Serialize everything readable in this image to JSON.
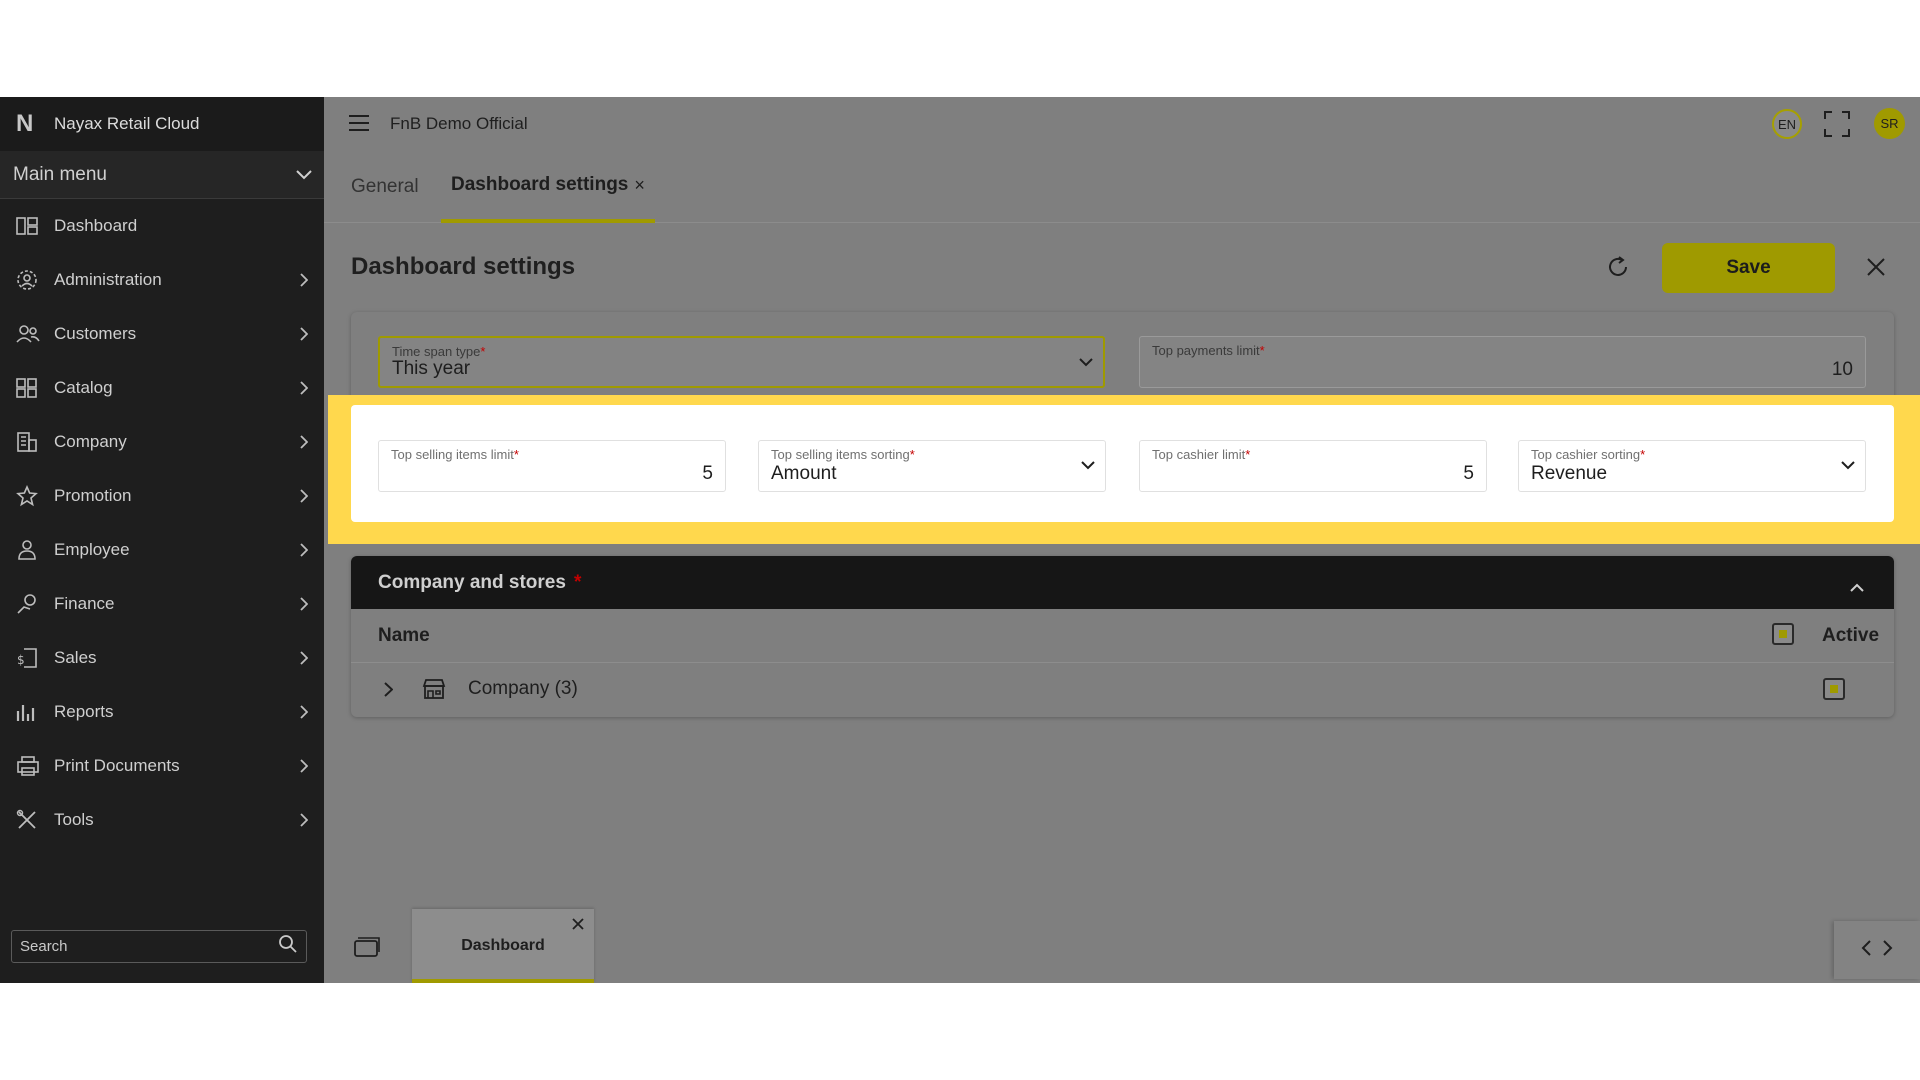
{
  "sidebar": {
    "brand_logo": "N",
    "brand_name": "Nayax Retail Cloud",
    "main_menu_label": "Main menu",
    "items": [
      {
        "label": "Dashboard",
        "icon": "dashboard-icon"
      },
      {
        "label": "Administration",
        "icon": "gear-user-icon"
      },
      {
        "label": "Customers",
        "icon": "users-icon"
      },
      {
        "label": "Catalog",
        "icon": "grid-icon"
      },
      {
        "label": "Company",
        "icon": "building-icon"
      },
      {
        "label": "Promotion",
        "icon": "star-icon"
      },
      {
        "label": "Employee",
        "icon": "person-icon"
      },
      {
        "label": "Finance",
        "icon": "hand-coin-icon"
      },
      {
        "label": "Sales",
        "icon": "receipt-dollar-icon"
      },
      {
        "label": "Reports",
        "icon": "bar-chart-icon"
      },
      {
        "label": "Print Documents",
        "icon": "printer-icon"
      },
      {
        "label": "Tools",
        "icon": "tools-icon"
      }
    ],
    "search_placeholder": "Search"
  },
  "topbar": {
    "store_name": "FnB Demo Official",
    "language": "EN",
    "avatar_initials": "SR"
  },
  "tabs": {
    "general": "General",
    "dashboard_settings": "Dashboard settings",
    "close_glyph": "×"
  },
  "page": {
    "title": "Dashboard settings",
    "save_label": "Save"
  },
  "settings": {
    "time_span_type": {
      "label": "Time span type",
      "value": "This year"
    },
    "top_payments_limit": {
      "label": "Top payments limit",
      "value": "10"
    },
    "top_selling_items_limit": {
      "label": "Top selling items limit",
      "value": "5"
    },
    "top_selling_items_sorting": {
      "label": "Top selling items sorting",
      "value": "Amount"
    },
    "top_cashier_limit": {
      "label": "Top cashier limit",
      "value": "5"
    },
    "top_cashier_sorting": {
      "label": "Top cashier sorting",
      "value": "Revenue"
    },
    "required_marker": "*"
  },
  "company_stores": {
    "title": "Company and stores",
    "required_marker": "*",
    "col_name": "Name",
    "col_active": "Active",
    "rows": [
      {
        "label": "Company (3)"
      }
    ]
  },
  "bottom": {
    "tab_label": "Dashboard"
  },
  "colors": {
    "accent": "#9f9a00",
    "highlight": "#ffd84d",
    "sidebar_bg": "#1e1e1e"
  }
}
